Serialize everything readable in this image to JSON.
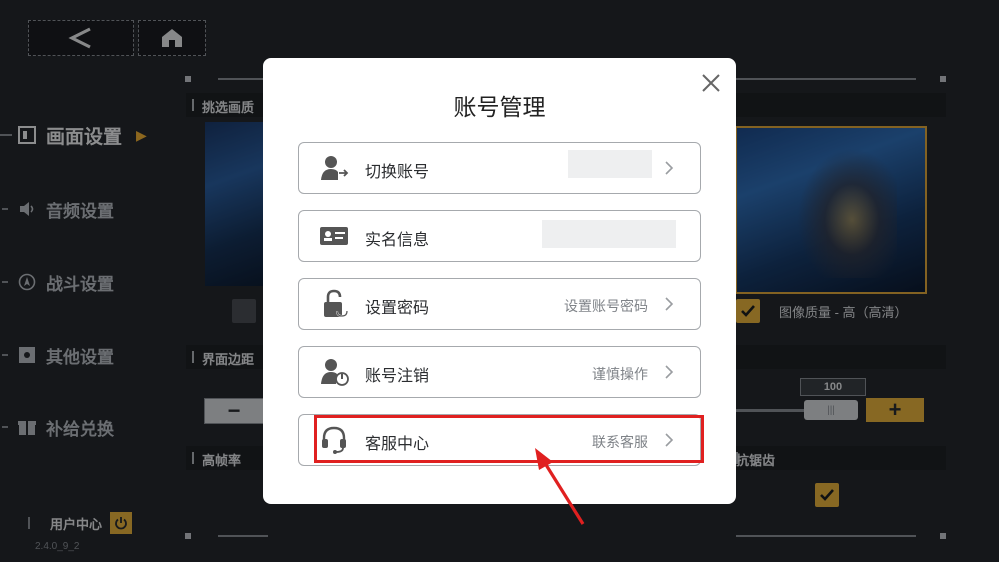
{
  "header": {
    "back_icon": "chevron-left-icon",
    "home_icon": "home-icon"
  },
  "sidebar": {
    "items": [
      {
        "label": "画面设置",
        "icon": "screen-icon",
        "active": true
      },
      {
        "label": "音频设置",
        "icon": "speaker-icon",
        "active": false
      },
      {
        "label": "战斗设置",
        "icon": "combat-icon",
        "active": false
      },
      {
        "label": "其他设置",
        "icon": "settings-icon",
        "active": false
      },
      {
        "label": "补给兑换",
        "icon": "gift-icon",
        "active": false
      }
    ],
    "user_center": "用户中心",
    "version": "2.4.0_9_2"
  },
  "content": {
    "section_quality": "挑选画质",
    "section_margin": "界面边距",
    "section_fps": "高帧率",
    "section_aa": "抗锯齿",
    "quality_label": "图像质量 - 高（高清）",
    "margin_value": "100",
    "margin_value_fraction": 1.0,
    "minus": "−",
    "plus": "+"
  },
  "modal": {
    "title": "账号管理",
    "rows": [
      {
        "label": "切换账号",
        "value": "",
        "icon": "switch-account-icon"
      },
      {
        "label": "实名信息",
        "value": "",
        "icon": "id-card-icon"
      },
      {
        "label": "设置密码",
        "value": "设置账号密码",
        "icon": "lock-icon"
      },
      {
        "label": "账号注销",
        "value": "谨慎操作",
        "icon": "user-logout-icon"
      },
      {
        "label": "客服中心",
        "value": "联系客服",
        "icon": "headset-icon"
      }
    ]
  },
  "colors": {
    "accent": "#e8b43d",
    "highlight": "#e02020",
    "background": "#25282d"
  }
}
